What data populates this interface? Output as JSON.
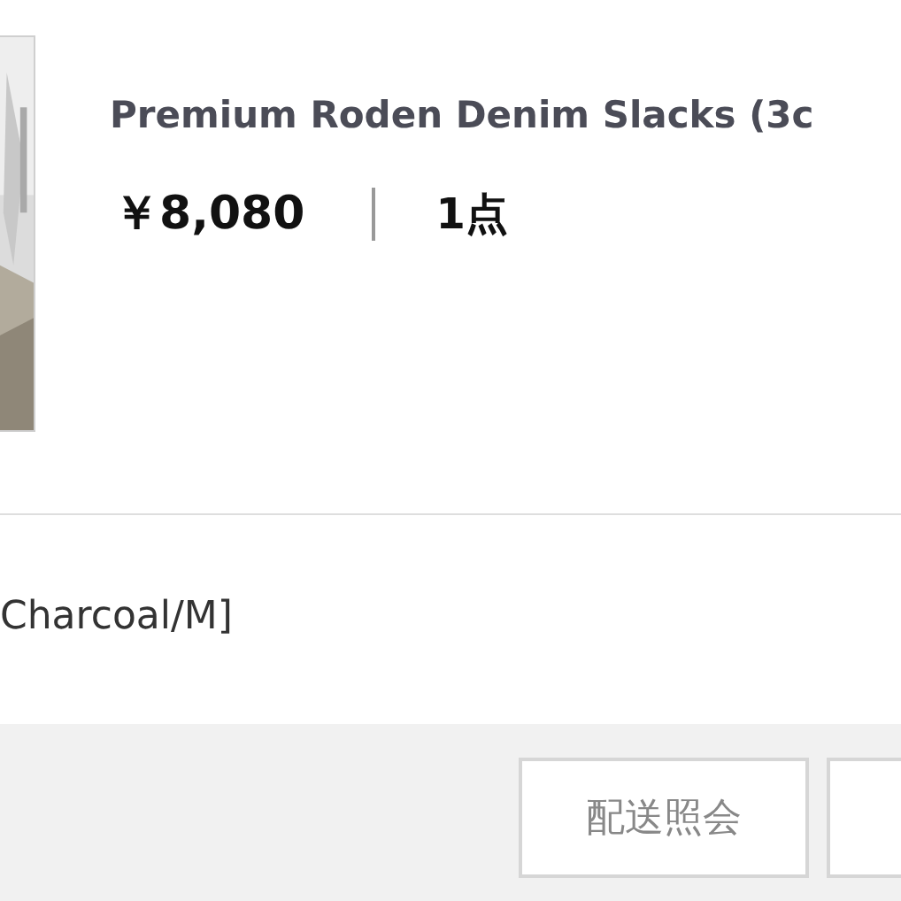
{
  "product": {
    "kind": "picture",
    "title": "Premium Roden Denim Slacks (3c",
    "price": "￥8,080",
    "quantity": "1点"
  },
  "option": "Charcoal/M]",
  "buttons": [
    {
      "kind": "labelled",
      "label": "配送照会"
    },
    {
      "kind": "cut"
    }
  ]
}
